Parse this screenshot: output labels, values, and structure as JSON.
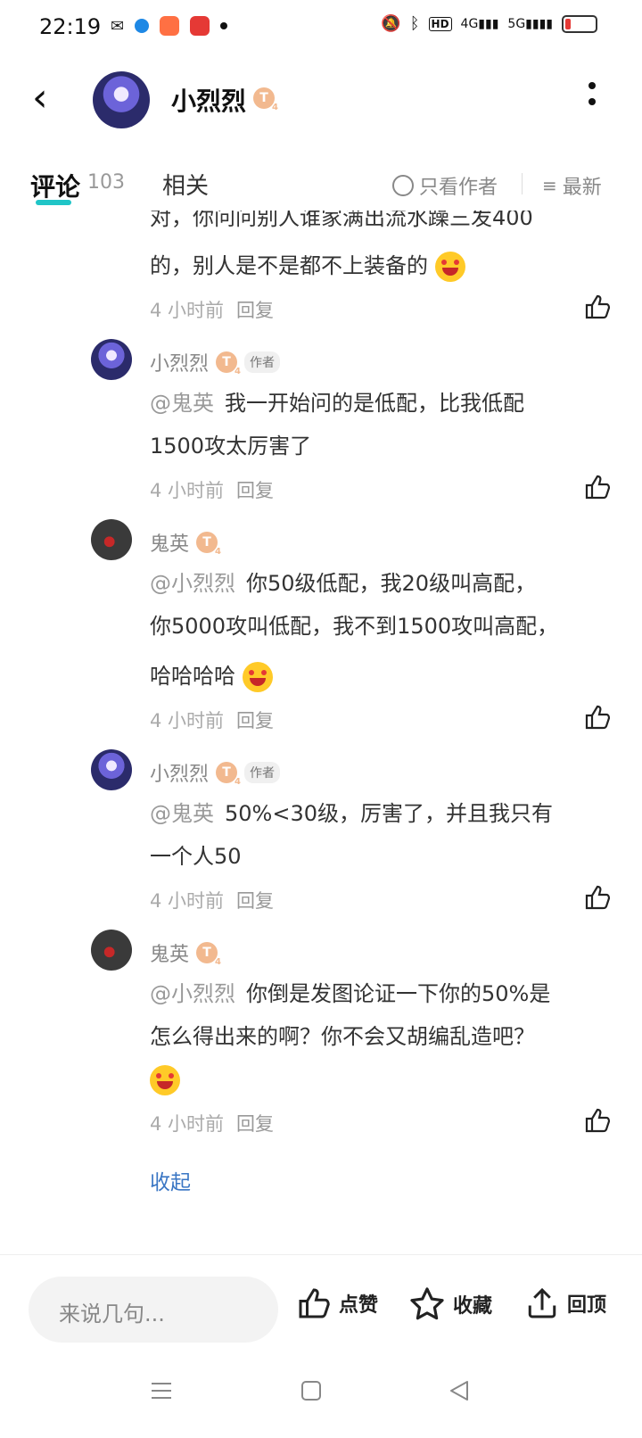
{
  "status": {
    "time": "22:19"
  },
  "header": {
    "title": "小烈烈",
    "badge": "T"
  },
  "tabs": {
    "comment": "评论",
    "comment_count": "103",
    "related": "相关",
    "author_only": "只看作者",
    "sort": "最新"
  },
  "cut_text": "对，你问问别人谁家满出流水躁三发400",
  "comments": [
    {
      "lines": [
        "的，别人是不是都不上装备的"
      ],
      "time": "4 小时前",
      "reply": "回复"
    },
    {
      "user": "小烈烈",
      "author_tag": "作者",
      "mention": "@鬼英",
      "lines": [
        "我一开始问的是低配，比我低配",
        "1500攻太厉害了"
      ],
      "time": "4 小时前",
      "reply": "回复"
    },
    {
      "user": "鬼英",
      "mention": "@小烈烈",
      "lines": [
        "你50级低配，我20级叫高配，",
        "你5000攻叫低配，我不到1500攻叫高配，",
        "哈哈哈哈"
      ],
      "time": "4 小时前",
      "reply": "回复"
    },
    {
      "user": "小烈烈",
      "author_tag": "作者",
      "mention": "@鬼英",
      "lines": [
        "50%<30级，厉害了，并且我只有",
        "一个人50"
      ],
      "time": "4 小时前",
      "reply": "回复"
    },
    {
      "user": "鬼英",
      "mention": "@小烈烈",
      "lines": [
        "你倒是发图论证一下你的50%是",
        "怎么得出来的啊？你不会又胡编乱造吧？"
      ],
      "time": "4 小时前",
      "reply": "回复"
    }
  ],
  "collapse": "收起",
  "bottom": {
    "placeholder": "来说几句...",
    "like": "点赞",
    "favorite": "收藏",
    "top": "回顶"
  },
  "colors": {
    "accent": "#20c5c7",
    "link": "#3a76c4",
    "badge": "#f2b98f"
  }
}
